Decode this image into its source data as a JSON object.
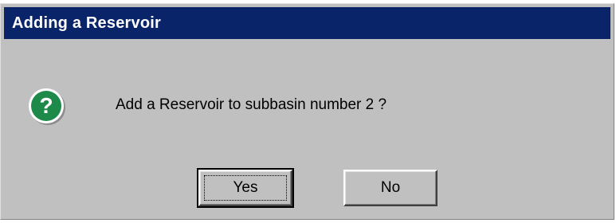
{
  "dialog": {
    "title": "Adding a Reservoir",
    "message": "Add a Reservoir to subbasin number 2 ?",
    "icon": "question-icon",
    "buttons": {
      "yes_label": "Yes",
      "no_label": "No"
    }
  },
  "colors": {
    "titlebar": "#0a246a",
    "face": "#c0c0c0",
    "icon_green": "#1e8a4a"
  }
}
